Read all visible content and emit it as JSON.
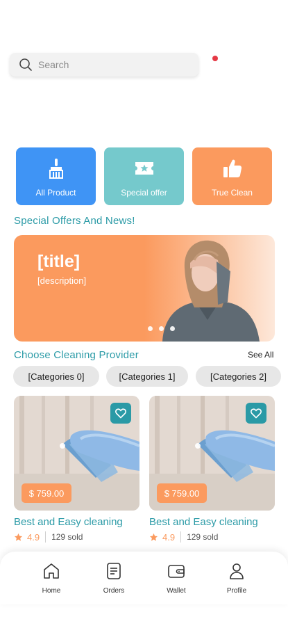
{
  "search": {
    "placeholder": "Search",
    "icon": "search-icon"
  },
  "notification": {
    "color": "#e53945"
  },
  "categories": [
    {
      "label": "All Product",
      "icon": "broom-icon",
      "color": "#3f94f5"
    },
    {
      "label": "Special offer",
      "icon": "ticket-star-icon",
      "color": "#75c9cc"
    },
    {
      "label": "True Clean",
      "icon": "thumbs-up-icon",
      "color": "#fb9a5e"
    }
  ],
  "offers": {
    "title": "Special Offers And News!",
    "banner": {
      "title": "[title]",
      "description": "[description]",
      "slides": 3
    }
  },
  "providers": {
    "title": "Choose Cleaning Provider",
    "see_all": "See All",
    "chips": [
      "[Categories 0]",
      "[Categories 1]",
      "[Categories 2]"
    ],
    "items": [
      {
        "title": "Best and Easy cleaning",
        "price": "$ 759.00",
        "rating": "4.9",
        "sold": "129 sold"
      },
      {
        "title": "Best and Easy cleaning",
        "price": "$ 759.00",
        "rating": "4.9",
        "sold": "129 sold"
      }
    ]
  },
  "nav": [
    {
      "label": "Home",
      "icon": "home-icon"
    },
    {
      "label": "Orders",
      "icon": "orders-icon"
    },
    {
      "label": "Wallet",
      "icon": "wallet-icon"
    },
    {
      "label": "Profile",
      "icon": "profile-icon"
    }
  ],
  "colors": {
    "accent": "#2a9aa6",
    "orange": "#fb9a5e",
    "blue": "#3f94f5",
    "teal": "#75c9cc"
  }
}
